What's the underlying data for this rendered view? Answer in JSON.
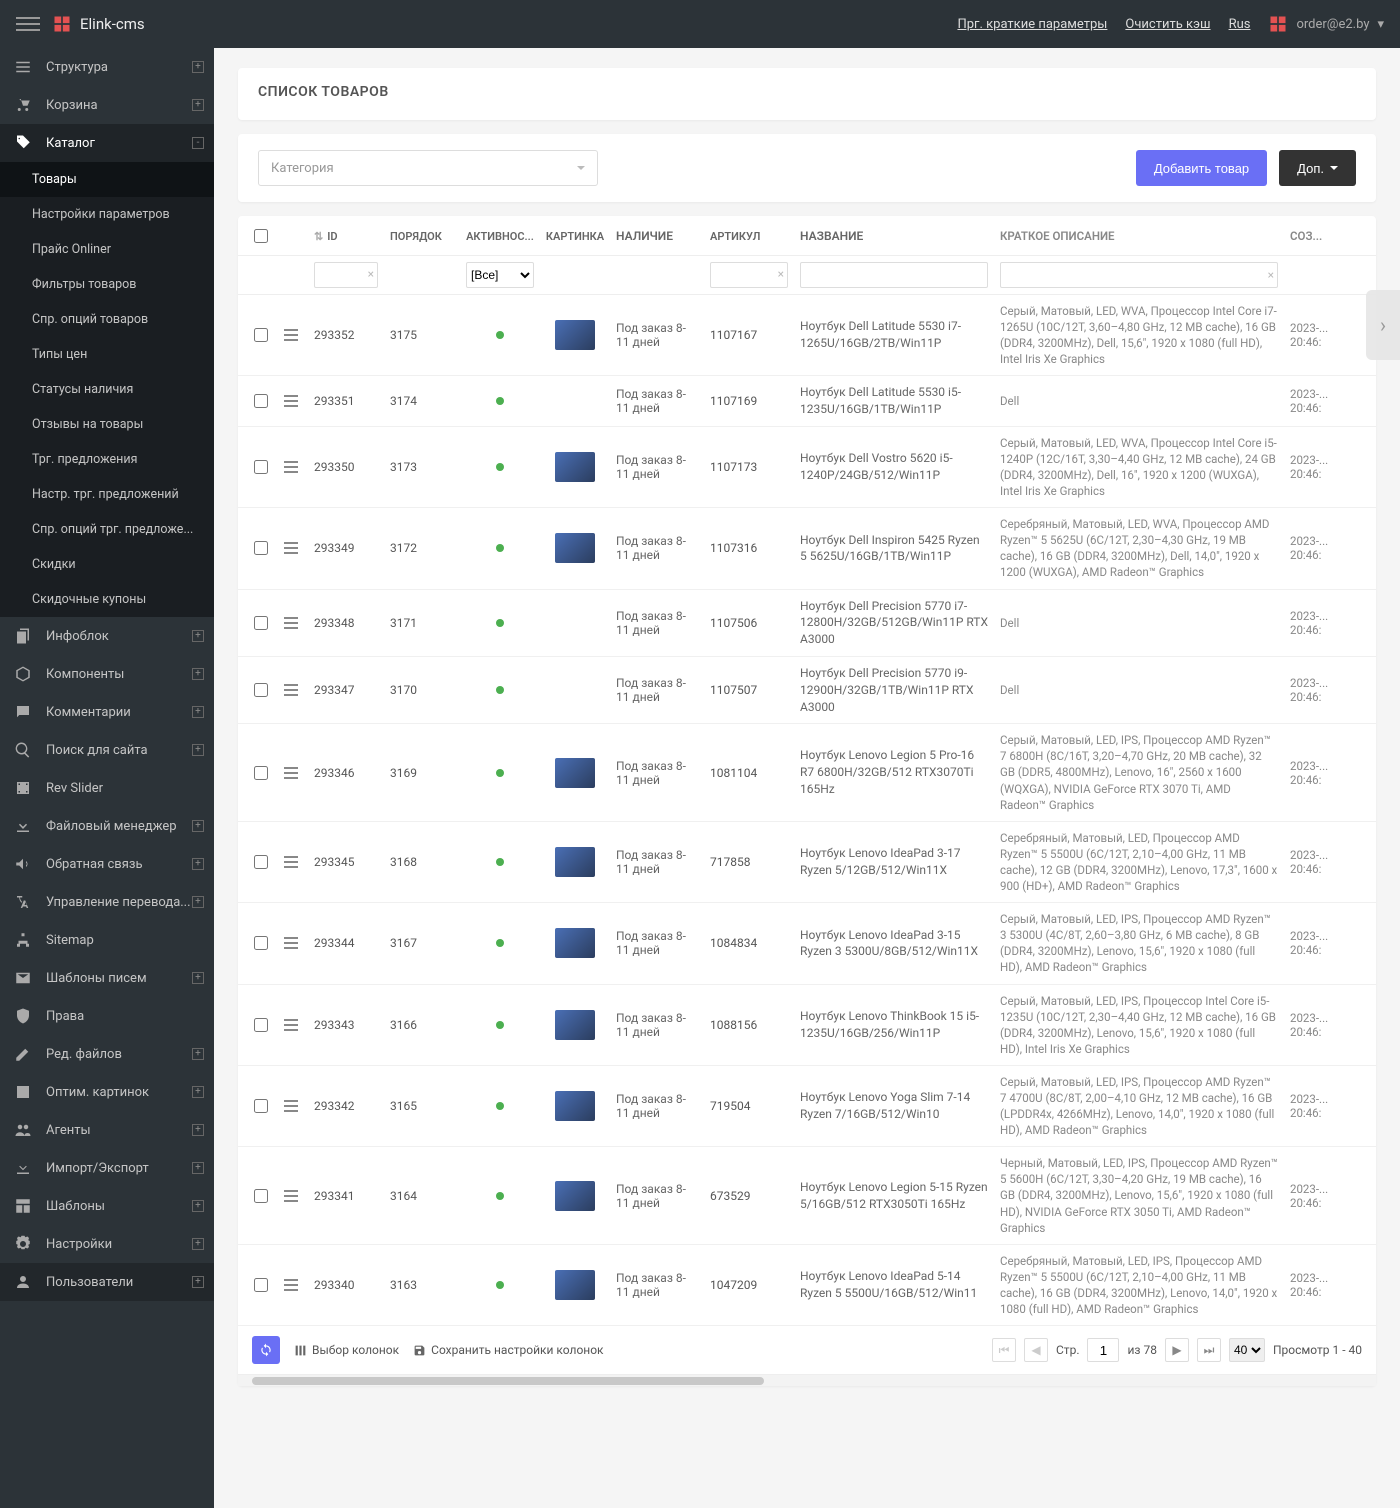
{
  "brand": "Elink-cms",
  "header": {
    "params_link": "Прг. краткие параметры",
    "clear_cache": "Очистить кэш",
    "lang": "Rus",
    "user_email": "order@e2.by"
  },
  "sidebar": {
    "main": [
      {
        "label": "Структура",
        "icon": "list",
        "expand": "+"
      },
      {
        "label": "Корзина",
        "icon": "cart",
        "expand": "+"
      },
      {
        "label": "Каталог",
        "icon": "tag",
        "expand": "-",
        "active": true
      }
    ],
    "catalog_sub": [
      {
        "label": "Товары",
        "selected": true
      },
      {
        "label": "Настройки параметров"
      },
      {
        "label": "Прайс Onliner"
      },
      {
        "label": "Фильтры товаров"
      },
      {
        "label": "Спр. опций товаров"
      },
      {
        "label": "Типы цен"
      },
      {
        "label": "Статусы наличия"
      },
      {
        "label": "Отзывы на товары"
      },
      {
        "label": "Трг. предложения"
      },
      {
        "label": "Настр. трг. предложений"
      },
      {
        "label": "Спр. опций трг. предложе..."
      },
      {
        "label": "Скидки"
      },
      {
        "label": "Скидочные купоны"
      }
    ],
    "rest": [
      {
        "label": "Инфоблок",
        "icon": "copy",
        "expand": "+"
      },
      {
        "label": "Компоненты",
        "icon": "cube",
        "expand": "+"
      },
      {
        "label": "Комментарии",
        "icon": "chat",
        "expand": "+"
      },
      {
        "label": "Поиск для сайта",
        "icon": "search",
        "expand": "+"
      },
      {
        "label": "Rev Slider",
        "icon": "film"
      },
      {
        "label": "Файловый менеджер",
        "icon": "download",
        "expand": "+"
      },
      {
        "label": "Обратная связь",
        "icon": "horn",
        "expand": "+"
      },
      {
        "label": "Управление перевода...",
        "icon": "translate",
        "expand": "+"
      },
      {
        "label": "Sitemap",
        "icon": "sitemap"
      },
      {
        "label": "Шаблоны писем",
        "icon": "mail",
        "expand": "+"
      },
      {
        "label": "Права",
        "icon": "shield"
      },
      {
        "label": "Ред. файлов",
        "icon": "edit",
        "expand": "+"
      },
      {
        "label": "Оптим. картинок",
        "icon": "image",
        "expand": "+"
      },
      {
        "label": "Агенты",
        "icon": "users",
        "expand": "+"
      },
      {
        "label": "Импорт/Экспорт",
        "icon": "import",
        "expand": "+"
      },
      {
        "label": "Шаблоны",
        "icon": "layout",
        "expand": "+"
      },
      {
        "label": "Настройки",
        "icon": "gear",
        "expand": "+"
      }
    ],
    "bottom": [
      {
        "label": "Пользователи",
        "icon": "user",
        "expand": "+"
      }
    ]
  },
  "page": {
    "title": "СПИСОК ТОВАРОВ",
    "category_placeholder": "Категория",
    "btn_add": "Добавить товар",
    "btn_extra": "Доп."
  },
  "table": {
    "headers": {
      "chk": "",
      "drag": "",
      "id": "ID",
      "order": "ПОРЯДОК",
      "active": "АКТИВНОС...",
      "img": "КАРТИНКА",
      "stock": "НАЛИЧИЕ",
      "art": "АРТИКУЛ",
      "name": "НАЗВАНИЕ",
      "desc": "КРАТКОЕ ОПИСАНИЕ",
      "created": "СОЗ..."
    },
    "filter_active_all": "[Все]",
    "rows": [
      {
        "id": "293352",
        "order": "3175",
        "stock": "Под заказ 8-11 дней",
        "art": "1107167",
        "name": "Ноутбук Dell Latitude 5530 i7-1265U/16GB/2TB/Win11P",
        "desc": "Серый, Матовый, LED, WVA, Процессор Intel Core i7-1265U (10C/12T, 3,60–4,80 GHz, 12 MB cache), 16 GB (DDR4, 3200MHz), Dell, 15,6\", 1920 x 1080 (full HD), Intel Iris Xe Graphics",
        "date": "2023-... 20:46:",
        "thumb": true
      },
      {
        "id": "293351",
        "order": "3174",
        "stock": "Под заказ 8-11 дней",
        "art": "1107169",
        "name": "Ноутбук Dell Latitude 5530 i5-1235U/16GB/1TB/Win11P",
        "desc": "Dell",
        "date": "2023-... 20:46:",
        "thumb": false
      },
      {
        "id": "293350",
        "order": "3173",
        "stock": "Под заказ 8-11 дней",
        "art": "1107173",
        "name": "Ноутбук Dell Vostro 5620 i5-1240P/24GB/512/Win11P",
        "desc": "Серый, Матовый, LED, WVA, Процессор Intel Core i5-1240P (12C/16T, 3,30–4,40 GHz, 12 MB cache), 24 GB (DDR4, 3200MHz), Dell, 16\", 1920 x 1200 (WUXGA), Intel Iris Xe Graphics",
        "date": "2023-... 20:46:",
        "thumb": true
      },
      {
        "id": "293349",
        "order": "3172",
        "stock": "Под заказ 8-11 дней",
        "art": "1107316",
        "name": "Ноутбук Dell Inspiron 5425 Ryzen 5 5625U/16GB/1TB/Win11P",
        "desc": "Серебряный, Матовый, LED, WVA, Процессор AMD Ryzen™ 5 5625U (6C/12T, 2,30–4,30 GHz, 19 MB cache), 16 GB (DDR4, 3200MHz), Dell, 14,0\", 1920 x 1200 (WUXGA), AMD Radeon™ Graphics",
        "date": "2023-... 20:46:",
        "thumb": true
      },
      {
        "id": "293348",
        "order": "3171",
        "stock": "Под заказ 8-11 дней",
        "art": "1107506",
        "name": "Ноутбук Dell Precision 5770 i7-12800H/32GB/512GB/Win11P RTX A3000",
        "desc": "Dell",
        "date": "2023-... 20:46:",
        "thumb": false
      },
      {
        "id": "293347",
        "order": "3170",
        "stock": "Под заказ 8-11 дней",
        "art": "1107507",
        "name": "Ноутбук Dell Precision 5770 i9-12900H/32GB/1TB/Win11P RTX A3000",
        "desc": "Dell",
        "date": "2023-... 20:46:",
        "thumb": false
      },
      {
        "id": "293346",
        "order": "3169",
        "stock": "Под заказ 8-11 дней",
        "art": "1081104",
        "name": "Ноутбук Lenovo Legion 5 Pro-16 R7 6800H/32GB/512 RTX3070Ti 165Hz",
        "desc": "Серый, Матовый, LED, IPS, Процессор AMD Ryzen™ 7 6800H (8C/16T, 3,20–4,70 GHz, 20 MB cache), 32 GB (DDR5, 4800MHz), Lenovo, 16\", 2560 x 1600 (WQXGA), NVIDIA GeForce RTX 3070 Ti, AMD Radeon™ Graphics",
        "date": "2023-... 20:46:",
        "thumb": true
      },
      {
        "id": "293345",
        "order": "3168",
        "stock": "Под заказ 8-11 дней",
        "art": "717858",
        "name": "Ноутбук Lenovo IdeaPad 3-17 Ryzen 5/12GB/512/Win11X",
        "desc": "Серебряный, Матовый, LED, Процессор AMD Ryzen™ 5 5500U (6C/12T, 2,10–4,00 GHz, 11 MB cache), 12 GB (DDR4, 3200MHz), Lenovo, 17,3\", 1600 x 900 (HD+), AMD Radeon™ Graphics",
        "date": "2023-... 20:46:",
        "thumb": true
      },
      {
        "id": "293344",
        "order": "3167",
        "stock": "Под заказ 8-11 дней",
        "art": "1084834",
        "name": "Ноутбук Lenovo IdeaPad 3-15 Ryzen 3 5300U/8GB/512/Win11X",
        "desc": "Серый, Матовый, LED, IPS, Процессор AMD Ryzen™ 3 5300U (4C/8T, 2,60–3,80 GHz, 6 MB cache), 8 GB (DDR4, 3200MHz), Lenovo, 15,6\", 1920 x 1080 (full HD), AMD Radeon™ Graphics",
        "date": "2023-... 20:46:",
        "thumb": true
      },
      {
        "id": "293343",
        "order": "3166",
        "stock": "Под заказ 8-11 дней",
        "art": "1088156",
        "name": "Ноутбук Lenovo ThinkBook 15 i5-1235U/16GB/256/Win11P",
        "desc": "Серый, Матовый, LED, IPS, Процессор Intel Core i5-1235U (10C/12T, 2,30–4,40 GHz, 12 MB cache), 16 GB (DDR4, 3200MHz), Lenovo, 15,6\", 1920 x 1080 (full HD), Intel Iris Xe Graphics",
        "date": "2023-... 20:46:",
        "thumb": true
      },
      {
        "id": "293342",
        "order": "3165",
        "stock": "Под заказ 8-11 дней",
        "art": "719504",
        "name": "Ноутбук Lenovo Yoga Slim 7-14 Ryzen 7/16GB/512/Win10",
        "desc": "Серый, Матовый, LED, IPS, Процессор AMD Ryzen™ 7 4700U (8C/8T, 2,00–4,10 GHz, 12 MB cache), 16 GB (LPDDR4x, 4266MHz), Lenovo, 14,0\", 1920 x 1080 (full HD), AMD Radeon™ Graphics",
        "date": "2023-... 20:46:",
        "thumb": true
      },
      {
        "id": "293341",
        "order": "3164",
        "stock": "Под заказ 8-11 дней",
        "art": "673529",
        "name": "Ноутбук Lenovo Legion 5-15 Ryzen 5/16GB/512 RTX3050Ti 165Hz",
        "desc": "Черный, Матовый, LED, IPS, Процессор AMD Ryzen™ 5 5600H (6C/12T, 3,30–4,20 GHz, 19 MB cache), 16 GB (DDR4, 3200MHz), Lenovo, 15,6\", 1920 x 1080 (full HD), NVIDIA GeForce RTX 3050 Ti, AMD Radeon™ Graphics",
        "date": "2023-... 20:46:",
        "thumb": true
      },
      {
        "id": "293340",
        "order": "3163",
        "stock": "Под заказ 8-11 дней",
        "art": "1047209",
        "name": "Ноутбук Lenovo IdeaPad 5-14 Ryzen 5 5500U/16GB/512/Win11",
        "desc": "Серебряный, Матовый, LED, IPS, Процессор AMD Ryzen™ 5 5500U (6C/12T, 2,10–4,00 GHz, 11 MB cache), 16 GB (DDR4, 3200MHz), Lenovo, 14,0\", 1920 x 1080 (full HD), AMD Radeon™ Graphics",
        "date": "2023-... 20:46:",
        "thumb": true
      }
    ]
  },
  "footer": {
    "select_cols": "Выбор колонок",
    "save_cols": "Сохранить настройки колонок",
    "page_label": "Стр.",
    "page": "1",
    "of_label": "из 78",
    "per_page": "40",
    "viewing": "Просмотр 1 - 40"
  }
}
